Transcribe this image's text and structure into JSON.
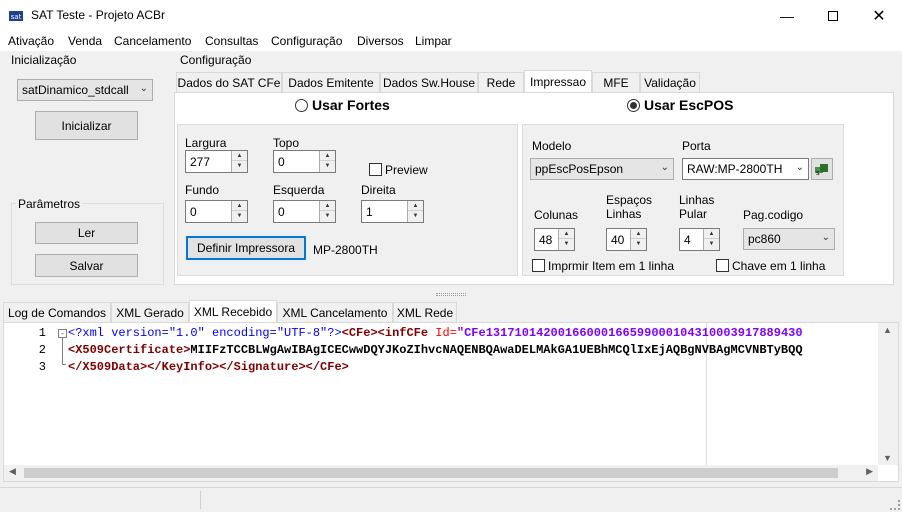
{
  "window": {
    "title": "SAT Teste - Projeto ACBr"
  },
  "menu": [
    "Ativação",
    "Venda",
    "Cancelamento",
    "Consultas",
    "Configuração",
    "Diversos",
    "Limpar"
  ],
  "inicializacao": {
    "group_title": "Inicialização",
    "lib_value": "satDinamico_stdcall",
    "init_button": "Inicializar"
  },
  "parametros": {
    "group_title": "Parâmetros",
    "read_button": "Ler",
    "save_button": "Salvar"
  },
  "configuracao": {
    "group_title": "Configuração",
    "tabs": [
      "Dados do SAT CFe",
      "Dados Emitente",
      "Dados Sw.House",
      "Rede",
      "Impressao",
      "MFE",
      "Validação"
    ],
    "active_tab": "Impressao"
  },
  "impressao": {
    "fortes": {
      "radio_label": "Usar Fortes",
      "largura_label": "Largura",
      "largura_value": "277",
      "topo_label": "Topo",
      "topo_value": "0",
      "preview_label": "Preview",
      "fundo_label": "Fundo",
      "fundo_value": "0",
      "esquerda_label": "Esquerda",
      "esquerda_value": "0",
      "direita_label": "Direita",
      "direita_value": "1",
      "define_button": "Definir Impressora",
      "printer_name": "MP-2800TH"
    },
    "escpos": {
      "radio_label": "Usar EscPOS",
      "modelo_label": "Modelo",
      "modelo_value": "ppEscPosEpson",
      "porta_label": "Porta",
      "porta_value": "RAW:MP-2800TH",
      "colunas_label": "Colunas",
      "colunas_value": "48",
      "espacos_label_1": "Espaços",
      "espacos_label_2": "Linhas",
      "espacos_value": "40",
      "linhas_label_1": "Linhas",
      "linhas_label_2": "Pular",
      "linhas_value": "4",
      "pagcod_label": "Pag.codigo",
      "pagcod_value": "pc860",
      "item_linha_label": "Imprmir Item em 1 linha",
      "chave_linha_label": "Chave em 1 linha"
    }
  },
  "bottom_tabs": [
    "Log de Comandos",
    "XML Gerado",
    "XML Recebido",
    "XML Cancelamento",
    "XML Rede"
  ],
  "bottom_active_tab": "XML Recebido",
  "editor": {
    "line_numbers": [
      "1",
      "2",
      "3"
    ],
    "line1": {
      "p1": "<?xml version=\"1.0\" encoding=\"UTF-8\"?>",
      "p2": "<CFe>",
      "p3": "<infCFe",
      "p4": " Id=",
      "p5": "\"CFe13171014200166000166599000104310003917889430"
    },
    "line2": {
      "p1": "<X509Certificate>",
      "p2": "MIIFzTCCBLWgAwIBAgICECwwDQYJKoZIhvcNAQENBQAwaDELMAkGA1UEBhMCQlIxEjAQBgNVBAgMCVNBTyBQQ"
    },
    "line3": {
      "p1": "</X509Data>",
      "p2": "</KeyInfo>",
      "p3": "</Signature>",
      "p4": "</CFe>"
    }
  },
  "colors": {
    "accent": "#0078d7",
    "xml_tag": "#0000ff",
    "xml_element": "#800000",
    "xml_attr": "#ff0000",
    "xml_value": "#8000ff"
  }
}
